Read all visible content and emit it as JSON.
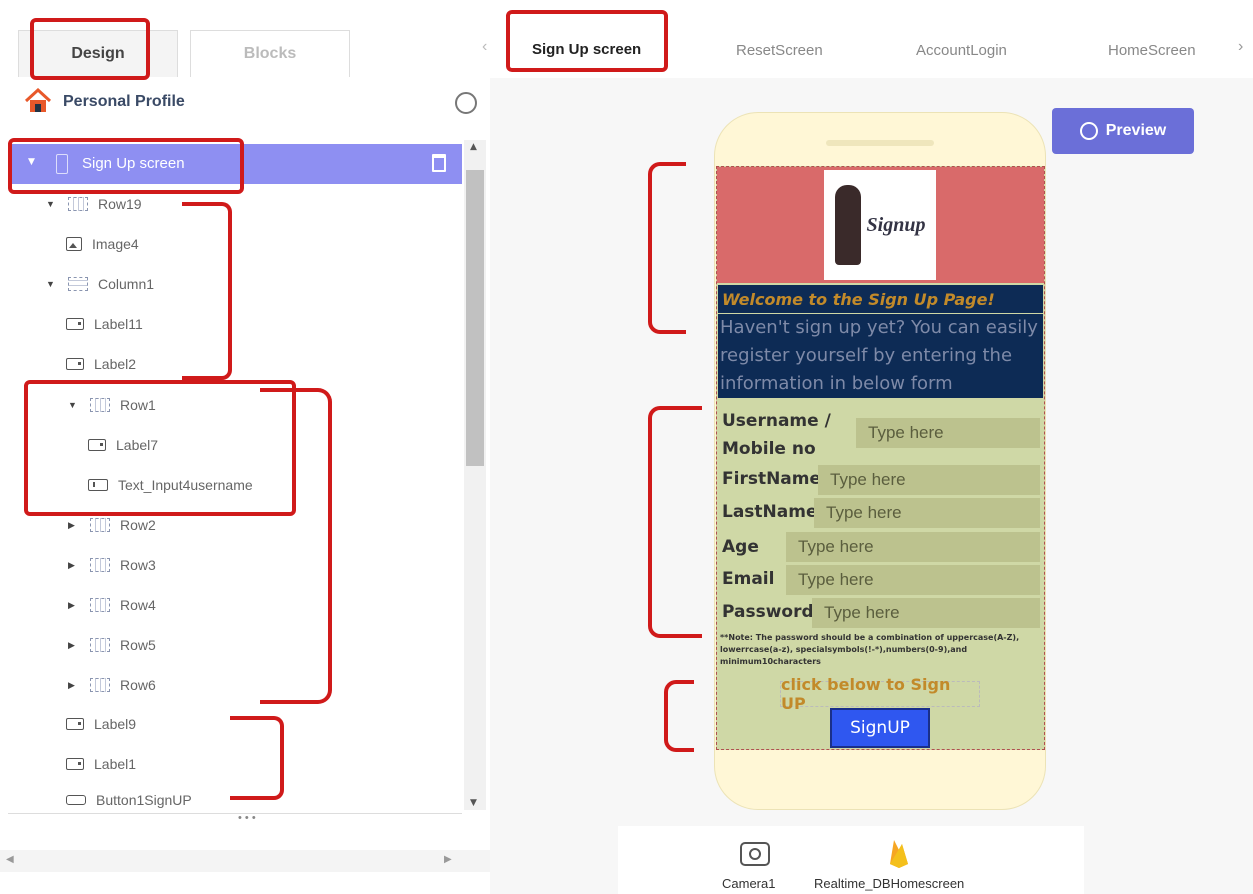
{
  "left_tabs": {
    "design": "Design",
    "blocks": "Blocks"
  },
  "screen_tabs": [
    "Sign Up screen",
    "ResetScreen",
    "AccountLogin",
    "HomeScreen"
  ],
  "project": {
    "name": "Personal Profile"
  },
  "tree": {
    "selected": "Sign Up screen",
    "nodes": [
      "Row19",
      "Image4",
      "Column1",
      "Label11",
      "Label2",
      "Row1",
      "Label7",
      "Text_Input4username",
      "Row2",
      "Row3",
      "Row4",
      "Row5",
      "Row6",
      "Label9",
      "Label1",
      "Button1SignUP"
    ]
  },
  "toolbar": {
    "preview_label": "Preview"
  },
  "phone": {
    "logo_text": "Signup",
    "welcome": "Welcome to the Sign Up Page!",
    "intro": "Haven't sign up yet? You can easily register yourself by entering the information in below form",
    "fields": [
      {
        "label": "Username / Mobile no",
        "placeholder": "Type here"
      },
      {
        "label": "FirstName",
        "placeholder": "Type here"
      },
      {
        "label": "LastName",
        "placeholder": "Type here"
      },
      {
        "label": "Age",
        "placeholder": "Type here"
      },
      {
        "label": "Email",
        "placeholder": "Type here"
      },
      {
        "label": "Password",
        "placeholder": "Type here"
      }
    ],
    "note": "**Note: The password should be a combination of uppercase(A-Z), lowerrcase(a-z), specialsymbols(!-*),numbers(0-9),and minimum10characters",
    "cta": "click below to Sign UP",
    "button": "SignUP"
  },
  "non_visible": [
    {
      "name": "Camera1"
    },
    {
      "name": "Realtime_DBHomescreen"
    }
  ],
  "colors": {
    "accent": "#8e8ff2",
    "annotation": "#d01a1a",
    "phone_bg": "#fff7d6",
    "header_bg": "#d96a6a",
    "welcome_bg": "#0d2b55",
    "form_bg": "#cfd8a6",
    "button": "#2f57f0"
  }
}
